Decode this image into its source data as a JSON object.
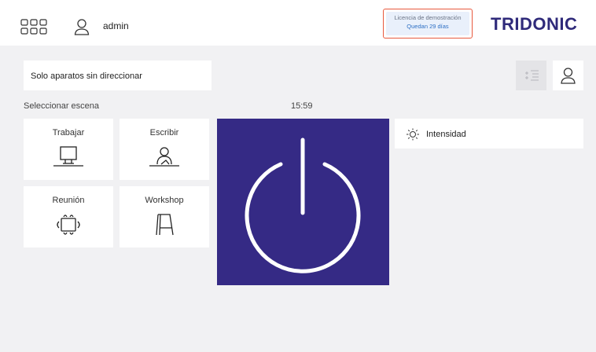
{
  "header": {
    "username": "admin",
    "license_title": "Licencia de demostración",
    "license_days": "Quedan 29 días",
    "logo": "TRIDONIC"
  },
  "filter": {
    "label": "Solo aparatos sin direccionar"
  },
  "scenes": {
    "section_label": "Seleccionar escena",
    "items": [
      {
        "label": "Trabajar",
        "icon": "computer-desk-icon"
      },
      {
        "label": "Escribir",
        "icon": "person-writing-icon"
      },
      {
        "label": "Reunión",
        "icon": "meeting-table-icon"
      },
      {
        "label": "Workshop",
        "icon": "flipchart-icon"
      }
    ]
  },
  "clock": "15:59",
  "power": {
    "icon": "power-icon",
    "color": "#352a85"
  },
  "intensity": {
    "label": "Intensidad",
    "icon": "sun-icon"
  },
  "colors": {
    "accent": "#352a85",
    "license_border": "#e8593d",
    "license_text": "#2d6fc4"
  }
}
